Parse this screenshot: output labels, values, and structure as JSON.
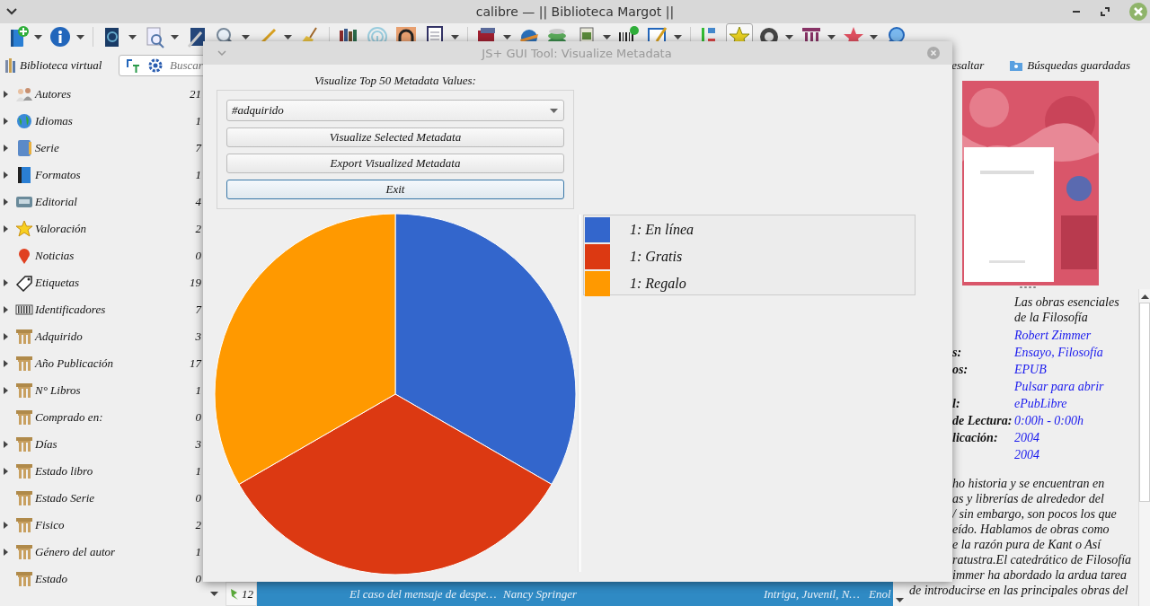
{
  "window": {
    "title": "calibre — || Biblioteca Margot ||"
  },
  "library_bar": {
    "virtual_library": "Biblioteca virtual",
    "search": {
      "placeholder": "Buscar"
    },
    "highlight": "esaltar",
    "saved_searches": "Búsquedas guardadas"
  },
  "tag_browser": {
    "items": [
      {
        "name": "Autores",
        "count": "21",
        "has_children": true
      },
      {
        "name": "Idiomas",
        "count": "1",
        "has_children": true
      },
      {
        "name": "Serie",
        "count": "7",
        "has_children": true
      },
      {
        "name": "Formatos",
        "count": "1",
        "has_children": true
      },
      {
        "name": "Editorial",
        "count": "4",
        "has_children": true
      },
      {
        "name": "Valoración",
        "count": "2",
        "has_children": true
      },
      {
        "name": "Noticias",
        "count": "0",
        "has_children": false
      },
      {
        "name": "Etiquetas",
        "count": "19",
        "has_children": true
      },
      {
        "name": "Identificadores",
        "count": "7",
        "has_children": true
      },
      {
        "name": "Adquirido",
        "count": "3",
        "has_children": true
      },
      {
        "name": "Año Publicación",
        "count": "17",
        "has_children": true
      },
      {
        "name": "N° Libros",
        "count": "1",
        "has_children": true
      },
      {
        "name": "Comprado en:",
        "count": "0",
        "has_children": false
      },
      {
        "name": "Días",
        "count": "3",
        "has_children": true
      },
      {
        "name": "Estado libro",
        "count": "1",
        "has_children": true
      },
      {
        "name": "Estado Serie",
        "count": "0",
        "has_children": false
      },
      {
        "name": "Fisico",
        "count": "2",
        "has_children": true
      },
      {
        "name": "Género del autor",
        "count": "1",
        "has_children": true
      },
      {
        "name": "Estado",
        "count": "0",
        "has_children": false
      }
    ]
  },
  "book_list": {
    "rows": [
      {
        "number": "12",
        "title": "El caso del mensaje de despe…",
        "author": "Nancy Springer",
        "tags": "Intriga, Juvenil, N…",
        "column_5": "Enol",
        "selected": true
      }
    ]
  },
  "book_details": {
    "cover": {
      "kind": "picture"
    },
    "title_lines": [
      "Las obras esenciales",
      "de la Filosofía"
    ],
    "fields": [
      {
        "value": "Robert Zimmer"
      },
      {
        "label": "s:",
        "value": "Ensayo, Filosofía"
      },
      {
        "label": "os:",
        "value": "EPUB"
      },
      {
        "value": "Pulsar para abrir"
      },
      {
        "label": "l:",
        "value": "ePubLibre"
      },
      {
        "label": "de Lectura:",
        "value": "0:00h - 0:00h"
      },
      {
        "label": "licación:",
        "value": "2004"
      },
      {
        "value": "2004"
      }
    ],
    "description_lines": [
      "ho historia y se encuentran en",
      "as y librerías de alrededor del",
      "/ sin embargo, son pocos los que",
      "eído. Hablamos de obras como",
      "e la razón pura de Kant o Así",
      "ratustra.El catedrático de Filosofía",
      "immer ha abordado la ardua tarea",
      "de introducirse en las principales obras del"
    ]
  },
  "dialog": {
    "title": "JS+ GUI Tool: Visualize Metadata",
    "heading": "Visualize Top 50 Metadata Values:",
    "dropdown": {
      "value": "#adquirido"
    },
    "buttons": [
      {
        "label": "Visualize Selected Metadata",
        "focused": false
      },
      {
        "label": "Export Visualized Metadata",
        "focused": false
      },
      {
        "label": "Exit",
        "focused": true
      }
    ],
    "legend": [
      {
        "color": "#3366cc"
      },
      {
        "color": "#dc3912"
      },
      {
        "color": "#ff9900"
      }
    ],
    "chart_data": {
      "type": "pie",
      "categories": [
        "1: En línea",
        "1: Gratis",
        "1: Regalo"
      ],
      "values": [
        1,
        1,
        1
      ]
    }
  }
}
